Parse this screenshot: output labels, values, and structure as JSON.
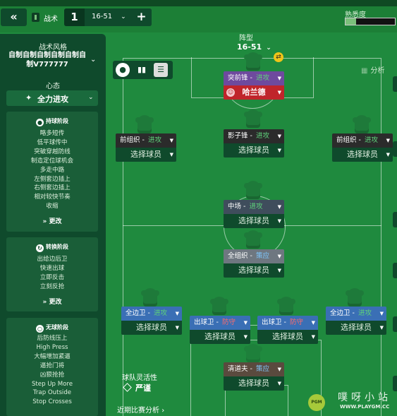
{
  "header": {
    "back_label": "«",
    "title": "战术",
    "slot_number": "1",
    "formation": "16-51",
    "add_label": "+",
    "familiarity_label": "熟悉度",
    "familiarity_fraction": 0.22
  },
  "left_panel": {
    "style_label": "战术风格",
    "style_name": "自制自制自制自制自制自制V777777",
    "mentality_label": "心态",
    "mentality_value": "全力进攻",
    "phases": [
      {
        "title": "持球阶段",
        "items": [
          "略多短传",
          "低平球传中",
          "突破穿越防线",
          "制造定位球机会",
          "多走中路",
          "左侧套边插上",
          "右侧套边插上",
          "相对较快节奏",
          "收缩"
        ],
        "more": "更改"
      },
      {
        "title": "转换阶段",
        "items": [
          "出给边后卫",
          "快速出球",
          "立即反击",
          "立刻反抢"
        ],
        "more": "更改"
      },
      {
        "title": "无球阶段",
        "items": [
          "后防线压上",
          "High Press",
          "大幅增加紧逼",
          "逼抢门将",
          "凶狠抢抢",
          "Step Up More",
          "Trap Outside",
          "Stop Crosses"
        ],
        "more": "更改"
      }
    ]
  },
  "pitch": {
    "formation_label": "阵型",
    "formation_name": "16-51",
    "analysis_label": "分析",
    "flexibility_label": "球队灵活性",
    "flexibility_value": "严谨",
    "recent_label": "近期比赛分析"
  },
  "positions": [
    {
      "role": "突前锋",
      "duty": "进攻",
      "player": "哈兰德",
      "role_color": "#6e4a9e",
      "assigned": true
    },
    {
      "role": "前组织",
      "duty": "进攻",
      "player": "选择球员",
      "role_color": "#2b2b2b",
      "assigned": false
    },
    {
      "role": "影子锋",
      "duty": "进攻",
      "player": "选择球员",
      "role_color": "#2b2b2b",
      "assigned": false
    },
    {
      "role": "前组织",
      "duty": "进攻",
      "player": "选择球员",
      "role_color": "#2b2b2b",
      "assigned": false
    },
    {
      "role": "中场",
      "duty": "进攻",
      "player": "选择球员",
      "role_color": "#3f4d5c",
      "assigned": false
    },
    {
      "role": "全组织",
      "duty": "策应",
      "player": "选择球员",
      "role_color": "#6e7780",
      "assigned": false
    },
    {
      "role": "全边卫",
      "duty": "进攻",
      "player": "选择球员",
      "role_color": "#3a6fb5",
      "assigned": false
    },
    {
      "role": "出球卫",
      "duty": "防守",
      "player": "选择球员",
      "role_color": "#3a6fb5",
      "assigned": false
    },
    {
      "role": "出球卫",
      "duty": "防守",
      "player": "选择球员",
      "role_color": "#3a6fb5",
      "assigned": false
    },
    {
      "role": "全边卫",
      "duty": "进攻",
      "player": "选择球员",
      "role_color": "#3a6fb5",
      "assigned": false
    },
    {
      "role": "清道夫",
      "duty": "策应",
      "player": "选择球员",
      "role_color": "#5a4a3e",
      "assigned": false
    }
  ],
  "watermark": {
    "logo_text": "PGM",
    "text": "噗呀小站",
    "url": "WWW.PLAYGM.CC"
  }
}
